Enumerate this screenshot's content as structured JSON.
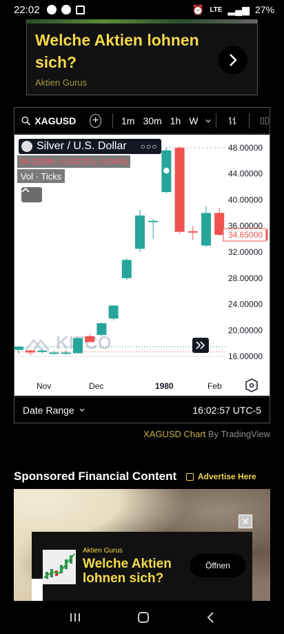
{
  "status": {
    "time": "22:02",
    "network": "LTE",
    "battery": "27%"
  },
  "top_ad": {
    "headline": "Welche Aktien lohnen sich?",
    "source": "Aktien Gurus"
  },
  "toolbar": {
    "symbol": "XAGUSD",
    "timeframes": [
      "1m",
      "30m",
      "1h",
      "W"
    ]
  },
  "legend": {
    "title": "Silver / U.S. Dollar",
    "values": "94.32090  −0.03720 (−0.04%)",
    "volume": "Vol · Ticks"
  },
  "watermark": "KITCO",
  "chart_data": {
    "type": "candlestick",
    "x_labels": [
      "Nov",
      "Dec",
      "1980",
      "Feb"
    ],
    "y_ticks": [
      "48.00000",
      "44.00000",
      "40.00000",
      "36.00000",
      "32.00000",
      "28.00000",
      "24.00000",
      "20.00000",
      "16.00000"
    ],
    "last_price": "34.65000",
    "ylim": [
      14,
      50
    ],
    "candles": [
      {
        "o": 17.0,
        "h": 17.6,
        "l": 16.4,
        "c": 17.5
      },
      {
        "o": 16.9,
        "h": 17.1,
        "l": 16.2,
        "c": 16.6
      },
      {
        "o": 16.8,
        "h": 17.2,
        "l": 16.5,
        "c": 16.9
      },
      {
        "o": 16.5,
        "h": 16.9,
        "l": 16.3,
        "c": 16.6
      },
      {
        "o": 16.6,
        "h": 16.9,
        "l": 16.3,
        "c": 16.6
      },
      {
        "o": 16.5,
        "h": 18.9,
        "l": 16.4,
        "c": 18.8
      },
      {
        "o": 19.1,
        "h": 19.4,
        "l": 18.3,
        "c": 18.2
      },
      {
        "o": 19.3,
        "h": 21.2,
        "l": 19.1,
        "c": 21.1
      },
      {
        "o": 21.8,
        "h": 23.9,
        "l": 21.5,
        "c": 23.8
      },
      {
        "o": 28.0,
        "h": 31.0,
        "l": 27.7,
        "c": 30.8
      },
      {
        "o": 32.5,
        "h": 38.5,
        "l": 32.0,
        "c": 37.6
      },
      {
        "o": 36.8,
        "h": 37.1,
        "l": 34.0,
        "c": 36.8
      },
      {
        "o": 41.2,
        "h": 48.0,
        "l": 41.0,
        "c": 47.6
      },
      {
        "o": 48.0,
        "h": 48.2,
        "l": 34.8,
        "c": 35.1
      },
      {
        "o": 35.2,
        "h": 36.0,
        "l": 33.8,
        "c": 35.0
      },
      {
        "o": 33.0,
        "h": 39.0,
        "l": 32.8,
        "c": 38.0
      },
      {
        "o": 38.0,
        "h": 38.8,
        "l": 34.5,
        "c": 34.65
      }
    ],
    "colors": {
      "up": "#26a69a",
      "down": "#ef5350"
    }
  },
  "footer": {
    "date_range": "Date Range",
    "time": "16:02:57 UTC-5"
  },
  "credit": {
    "link": "XAGUSD Chart",
    "by": " By TradingView"
  },
  "sponsored": {
    "title": "Sponsored Financial Content",
    "advertise": "Advertise Here"
  },
  "overlay_ad": {
    "brand": "Aktien Gurus",
    "headline": "Welche Aktien lohnen sich?",
    "button": "Öffnen"
  }
}
